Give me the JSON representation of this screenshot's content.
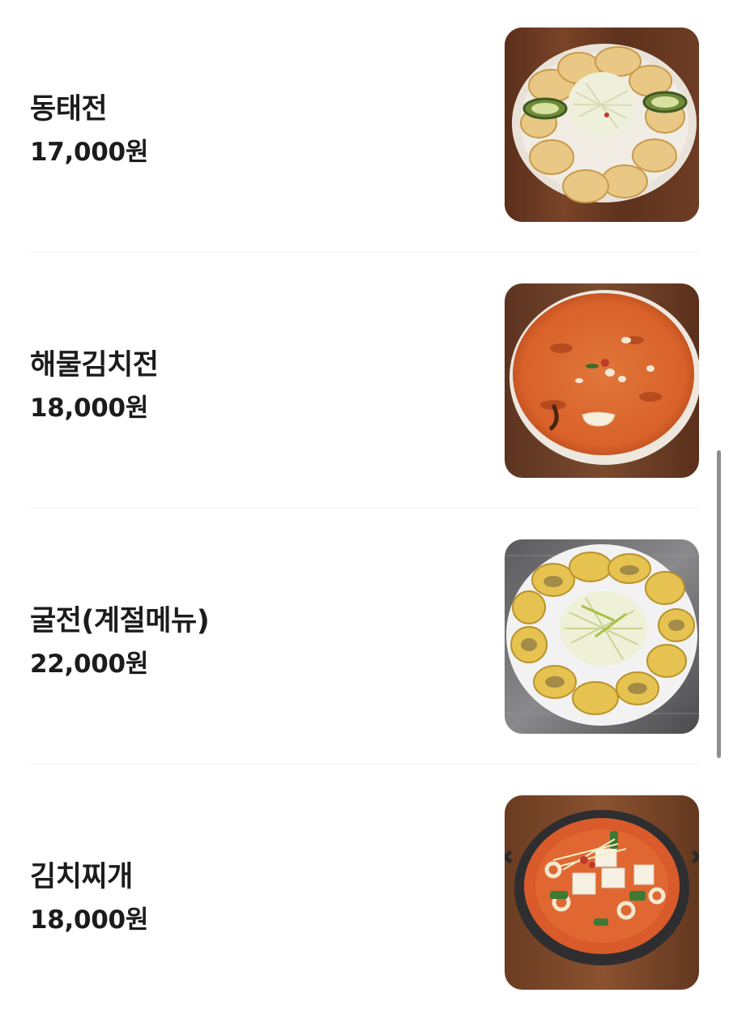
{
  "menu": {
    "items": [
      {
        "name": "동태전",
        "price": "17,000원",
        "image": "dongtae-jeon-photo"
      },
      {
        "name": "해물김치전",
        "price": "18,000원",
        "image": "seafood-kimchi-jeon-photo"
      },
      {
        "name": "굴전(계절메뉴)",
        "price": "22,000원",
        "image": "oyster-jeon-photo"
      },
      {
        "name": "김치찌개",
        "price": "18,000원",
        "image": "kimchi-jjigae-photo"
      }
    ]
  },
  "colors": {
    "text": "#1c1c1e",
    "divider": "#eeeeee",
    "scrollbar": "#8e8e93",
    "wood": "#6b3a22"
  }
}
